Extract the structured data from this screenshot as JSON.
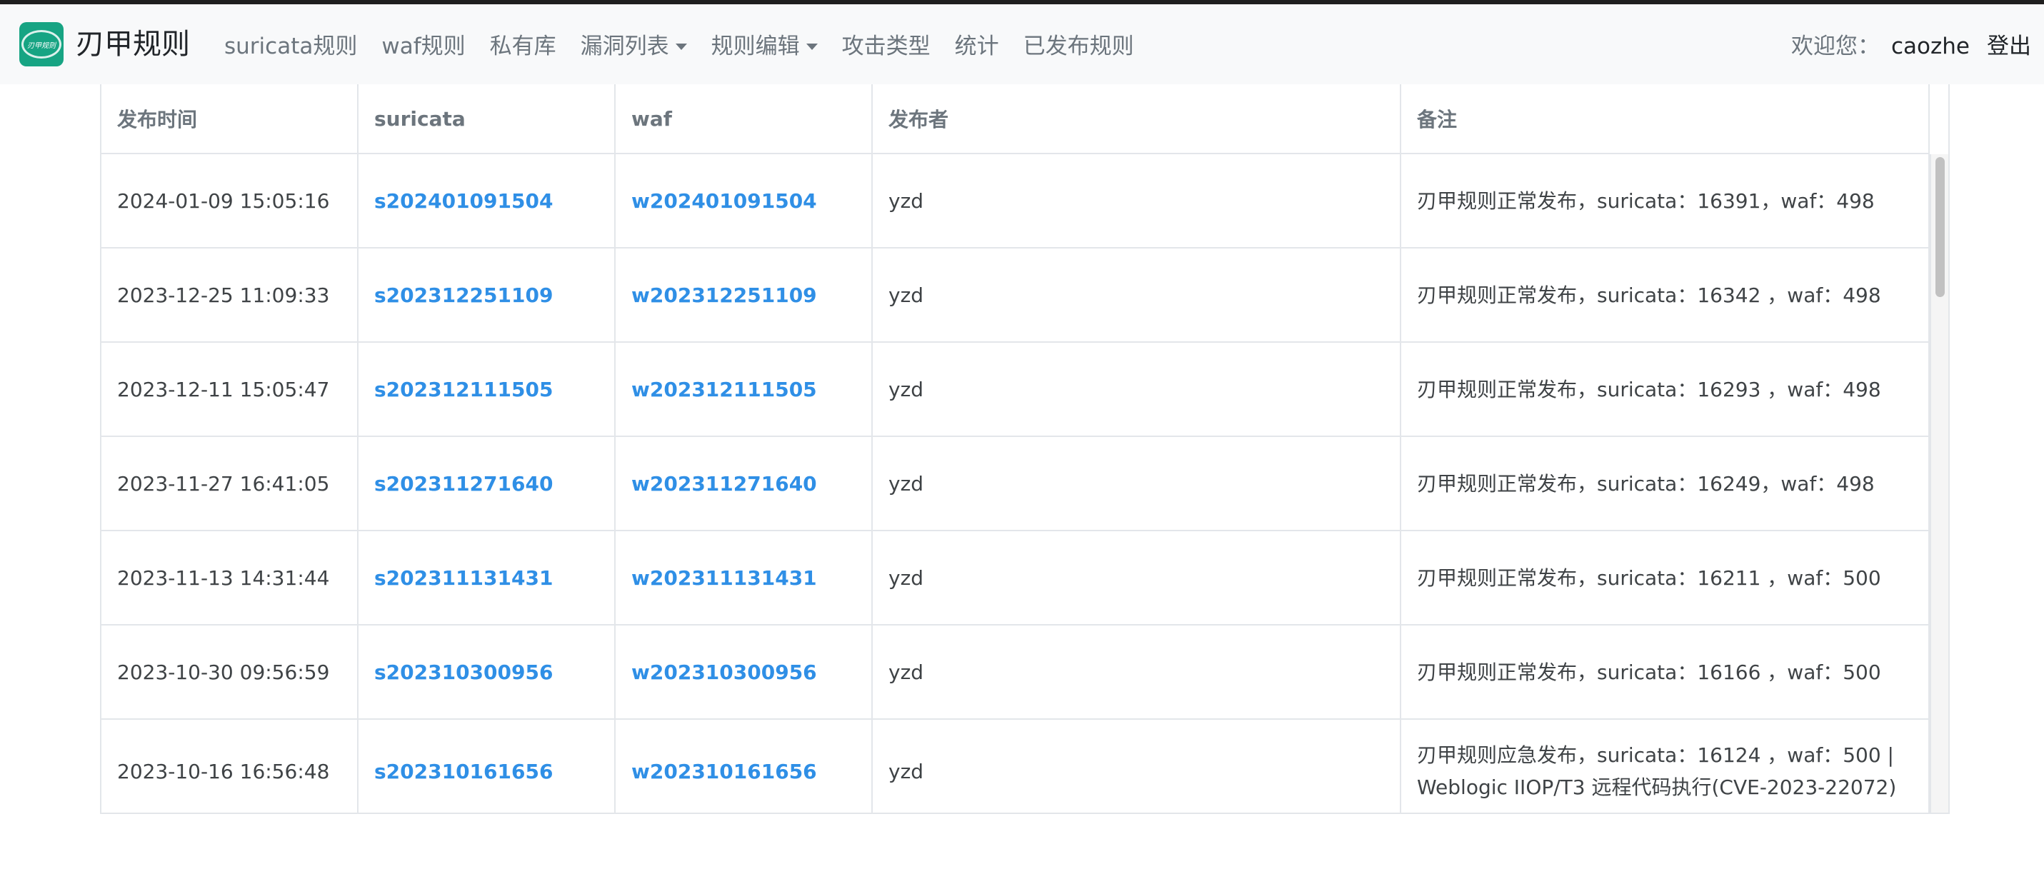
{
  "brand": {
    "logo_text": "刃甲规则",
    "name": "刃甲规则"
  },
  "nav": {
    "items": [
      {
        "label": "suricata规则"
      },
      {
        "label": "waf规则"
      },
      {
        "label": "私有库"
      },
      {
        "label": "漏洞列表",
        "dropdown": true
      },
      {
        "label": "规则编辑",
        "dropdown": true
      },
      {
        "label": "攻击类型"
      },
      {
        "label": "统计"
      },
      {
        "label": "已发布规则"
      }
    ],
    "welcome": "欢迎您：",
    "user": "caozhe",
    "logout": "登出"
  },
  "table": {
    "headers": [
      "发布时间",
      "suricata",
      "waf",
      "发布者",
      "备注"
    ],
    "rows": [
      {
        "time": "2024-01-09 15:05:16",
        "suricata": "s202401091504",
        "waf": "w202401091504",
        "publisher": "yzd",
        "note": "刃甲规则正常发布，suricata：16391，waf：498"
      },
      {
        "time": "2023-12-25 11:09:33",
        "suricata": "s202312251109",
        "waf": "w202312251109",
        "publisher": "yzd",
        "note": "刃甲规则正常发布，suricata：16342 ，waf：498"
      },
      {
        "time": "2023-12-11 15:05:47",
        "suricata": "s202312111505",
        "waf": "w202312111505",
        "publisher": "yzd",
        "note": "刃甲规则正常发布，suricata：16293 ，waf：498"
      },
      {
        "time": "2023-11-27 16:41:05",
        "suricata": "s202311271640",
        "waf": "w202311271640",
        "publisher": "yzd",
        "note": "刃甲规则正常发布，suricata：16249，waf：498"
      },
      {
        "time": "2023-11-13 14:31:44",
        "suricata": "s202311131431",
        "waf": "w202311131431",
        "publisher": "yzd",
        "note": "刃甲规则正常发布，suricata：16211 ，waf：500"
      },
      {
        "time": "2023-10-30 09:56:59",
        "suricata": "s202310300956",
        "waf": "w202310300956",
        "publisher": "yzd",
        "note": "刃甲规则正常发布，suricata：16166 ，waf：500"
      },
      {
        "time": "2023-10-16 16:56:48",
        "suricata": "s202310161656",
        "waf": "w202310161656",
        "publisher": "yzd",
        "note": "刃甲规则应急发布，suricata：16124 ，waf：500 | Weblogic IIOP/T3 远程代码执行(CVE-2023-22072)"
      }
    ]
  },
  "colors": {
    "brand": "#17a483",
    "link": "#2f8fe6",
    "navbar_bg": "#f8f9fa",
    "border": "#e3e6ea"
  }
}
